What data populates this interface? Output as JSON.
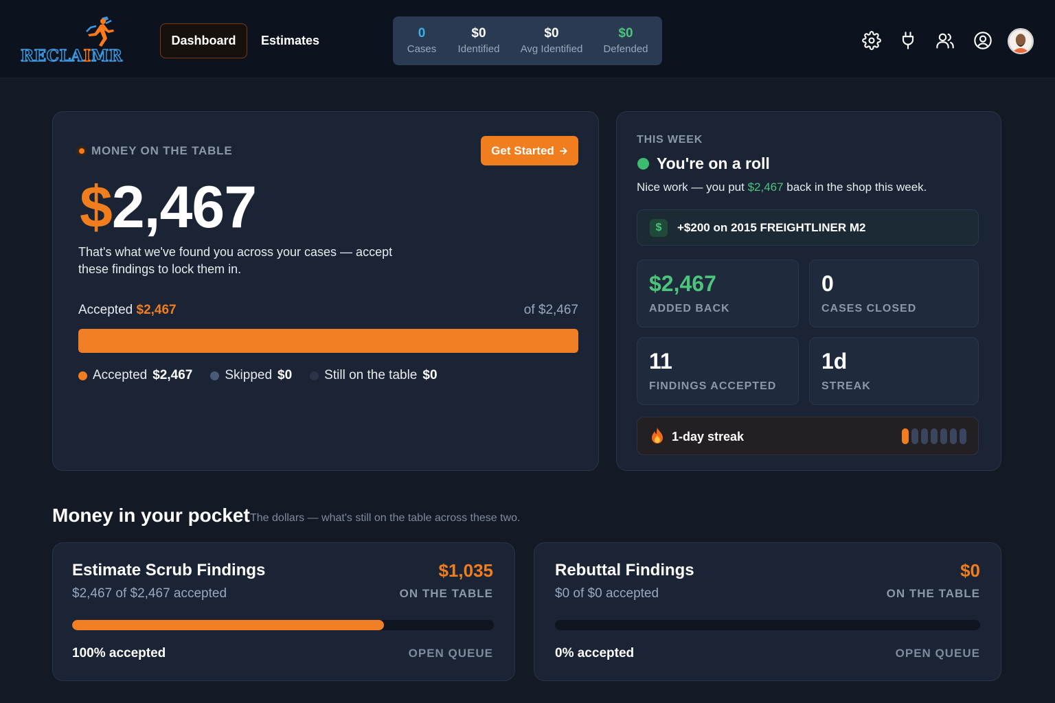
{
  "app": {
    "logo_text_a": "RECLA",
    "logo_text_b": "I",
    "logo_text_c": "MR",
    "brand_colors": {
      "blue": "#3b9ce6",
      "orange": "#ff7a1a"
    }
  },
  "nav": {
    "dashboard": "Dashboard",
    "estimates": "Estimates"
  },
  "header_stats": [
    {
      "value": "0",
      "label": "Cases",
      "color": "#3bb0e6"
    },
    {
      "value": "$0",
      "label": "Identified",
      "color": "#ffffff"
    },
    {
      "value": "$0",
      "label": "Avg Identified",
      "color": "#ffffff"
    },
    {
      "value": "$0",
      "label": "Defended",
      "color": "#4cc47c"
    }
  ],
  "header_icons": [
    "gear-icon",
    "plug-icon",
    "users-icon",
    "user-circle-icon"
  ],
  "money_on_table": {
    "label": "MONEY ON THE TABLE",
    "cta": "Get Started",
    "currency": "$",
    "amount": "2,467",
    "description": "That's what we've found you across your cases — accept these findings to lock them in.",
    "accepted_label": "Accepted",
    "accepted_amount": "$2,467",
    "of_total": "of $2,467",
    "progress_fraction": 1.0,
    "legend": [
      {
        "label": "Accepted",
        "value": "$2,467",
        "color": "#f07d1e"
      },
      {
        "label": "Skipped",
        "value": "$0",
        "color": "#4b5b75"
      },
      {
        "label": "Still on the table",
        "value": "$0",
        "color": "#2a3446"
      }
    ]
  },
  "this_week": {
    "label": "THIS WEEK",
    "title": "You're on a roll",
    "sub_before": "Nice work — you put ",
    "sub_amount": "$2,467",
    "sub_after": " back in the shop this week.",
    "gain_icon": "$",
    "gain_text": "+$200 on 2015 FREIGHTLINER M2",
    "tiles": [
      {
        "value": "$2,467",
        "label": "ADDED BACK",
        "color": "#4cc47c"
      },
      {
        "value": "0",
        "label": "CASES CLOSED",
        "color": "#ffffff"
      },
      {
        "value": "11",
        "label": "FINDINGS ACCEPTED",
        "color": "#ffffff"
      },
      {
        "value": "1d",
        "label": "STREAK",
        "color": "#ffffff"
      }
    ],
    "streak_text": "1-day streak",
    "streak_days_on": 1,
    "streak_days_total": 7
  },
  "pocket": {
    "title": "Money in your pocket",
    "subtitle": "The dollars — what's still on the table across these two.",
    "cards": [
      {
        "title": "Estimate Scrub Findings",
        "sub": "$2,467 of $2,467 accepted",
        "amount": "$1,035",
        "on_table": "ON THE TABLE",
        "progress_fraction": 0.74,
        "pct": "100% accepted",
        "queue": "OPEN QUEUE"
      },
      {
        "title": "Rebuttal Findings",
        "sub": "$0 of $0 accepted",
        "amount": "$0",
        "on_table": "ON THE TABLE",
        "progress_fraction": 0,
        "pct": "0% accepted",
        "queue": "OPEN QUEUE"
      }
    ]
  }
}
